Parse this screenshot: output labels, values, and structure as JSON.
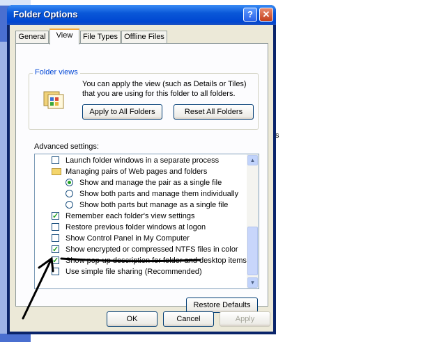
{
  "dialog": {
    "title": "Folder Options",
    "help_glyph": "?",
    "close_glyph": "✕"
  },
  "tabs": [
    {
      "label": "General"
    },
    {
      "label": "View"
    },
    {
      "label": "File Types"
    },
    {
      "label": "Offline Files"
    }
  ],
  "folder_views": {
    "label": "Folder views",
    "description": "You can apply the view (such as Details or Tiles) that you are using for this folder to all folders.",
    "apply_button": "Apply to All Folders",
    "reset_button": "Reset All Folders"
  },
  "advanced": {
    "label": "Advanced settings:",
    "items": [
      {
        "text": "Launch folder windows in a separate process",
        "kind": "checkbox",
        "checked": false,
        "indent": 0
      },
      {
        "text": "Managing pairs of Web pages and folders",
        "kind": "folder",
        "checked": false,
        "indent": 0
      },
      {
        "text": "Show and manage the pair as a single file",
        "kind": "radio",
        "checked": true,
        "indent": 1
      },
      {
        "text": "Show both parts and manage them individually",
        "kind": "radio",
        "checked": false,
        "indent": 1
      },
      {
        "text": "Show both parts but manage as a single file",
        "kind": "radio",
        "checked": false,
        "indent": 1
      },
      {
        "text": "Remember each folder's view settings",
        "kind": "checkbox",
        "checked": true,
        "indent": 0
      },
      {
        "text": "Restore previous folder windows at logon",
        "kind": "checkbox",
        "checked": false,
        "indent": 0
      },
      {
        "text": "Show Control Panel in My Computer",
        "kind": "checkbox",
        "checked": false,
        "indent": 0
      },
      {
        "text": "Show encrypted or compressed NTFS files in color",
        "kind": "checkbox",
        "checked": true,
        "indent": 0
      },
      {
        "text": "Show pop-up description for folder and desktop items",
        "kind": "checkbox",
        "checked": true,
        "indent": 0
      },
      {
        "text": "Use simple file sharing (Recommended)",
        "kind": "checkbox",
        "checked": false,
        "indent": 0
      }
    ],
    "scroll_up": "▲",
    "scroll_down": "▼",
    "restore_button": "Restore Defaults"
  },
  "footer": {
    "ok": "OK",
    "cancel": "Cancel",
    "apply": "Apply"
  },
  "background": {
    "stray_text": "s"
  }
}
